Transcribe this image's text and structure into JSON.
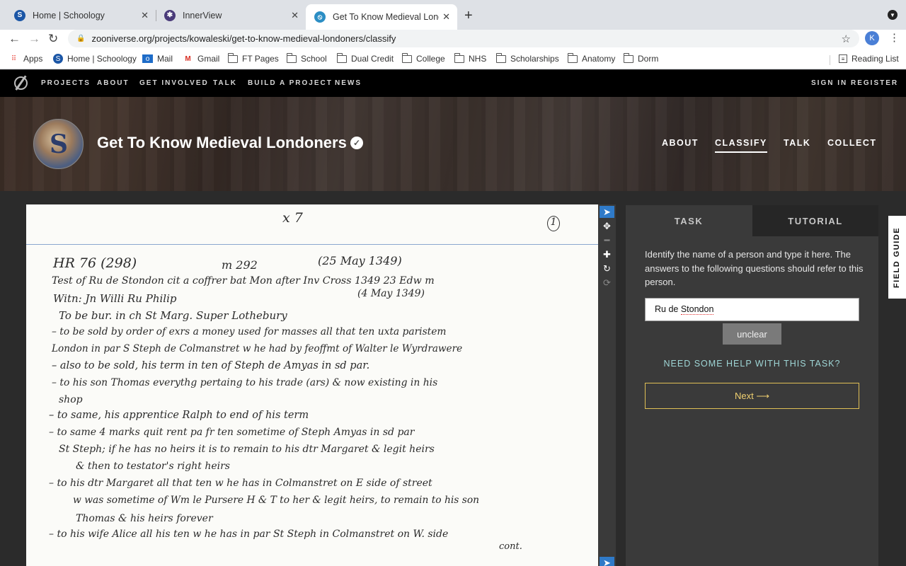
{
  "browser": {
    "tabs": [
      {
        "title": "Home | Schoology",
        "icon": "S",
        "color": "#1b56a6"
      },
      {
        "title": "InnerView",
        "icon": "✱",
        "color": "#4a3b7a"
      },
      {
        "title": "Get To Know Medieval Londoners",
        "icon": "⦸",
        "color": "#2c8ec4"
      }
    ],
    "new_tab": "+",
    "url": "zooniverse.org/projects/kowaleski/get-to-know-medieval-londoners/classify",
    "profile_initial": "K",
    "bookmarks": [
      "Apps",
      "Home | Schoology",
      "Mail",
      "Gmail",
      "FT Pages",
      "School",
      "Dual Credit",
      "College",
      "NHS",
      "Scholarships",
      "Anatomy",
      "Dorm"
    ],
    "reading_list": "Reading List"
  },
  "site_nav": {
    "links": [
      "PROJECTS",
      "ABOUT",
      "GET INVOLVED",
      "TALK",
      "BUILD A PROJECT",
      "NEWS"
    ],
    "sign_in": "SIGN IN",
    "register": "REGISTER"
  },
  "project": {
    "title": "Get To Know Medieval Londoners",
    "nav": [
      "ABOUT",
      "CLASSIFY",
      "TALK",
      "COLLECT"
    ],
    "active_nav": "CLASSIFY"
  },
  "manuscript": {
    "lines": [
      "x 7",
      "1",
      "HR 76 (298)",
      "m 292",
      "(25 May 1349)",
      "Test of   Ru de Stondon   cit a coffrer   bat   Mon after Inv Cross   1349   23 Edw m",
      "(4 May 1349)",
      "Witn: Jn Willi    Ru Philip",
      "To be bur. in ch   St Marg. Super Lothebury",
      "– to be sold by order of exrs a money used for masses all that ten uxta paristem",
      "London in par S Steph de Colmanstret w he had by feoffmt of Walter le Wyrdrawere",
      "– also to be sold, his term in ten of Steph de Amyas in sd par.",
      "– to his son Thomas everythg pertaing to his trade (ars) & now existing in his",
      "shop",
      "– to same, his apprentice Ralph   to end of his term",
      "– to same   4 marks quit rent   pa fr ten   sometime of Steph Amyas in sd par",
      "St Steph;  if he has no heirs  it is to remain to his dtr Margaret & legit heirs",
      "& then to testator's  right heirs",
      "– to his dtr Margaret  all that  ten w he has  in  Colmanstret  on E side of street",
      "w was sometime of  Wm le Pursere     H & T to her & legit heirs, to remain to his son",
      "Thomas & his heirs forever",
      "– to his wife Alice  all his ten w he has in par  St Steph in Colmanstret  on W. side",
      "cont."
    ]
  },
  "image_tools": [
    "pointer-icon",
    "move-icon",
    "minus-icon",
    "plus-icon",
    "rotate-icon",
    "reset-icon"
  ],
  "task_panel": {
    "tabs": [
      "TASK",
      "TUTORIAL"
    ],
    "instruction": "Identify the name of a person and type it here. The answers to the following questions should refer to this person.",
    "input_prefix": "Ru de ",
    "input_misspelled": "Stondon",
    "unclear": "unclear",
    "help": "NEED SOME HELP WITH THIS TASK?",
    "next": "Next ⟶"
  },
  "field_guide": "FIELD GUIDE"
}
